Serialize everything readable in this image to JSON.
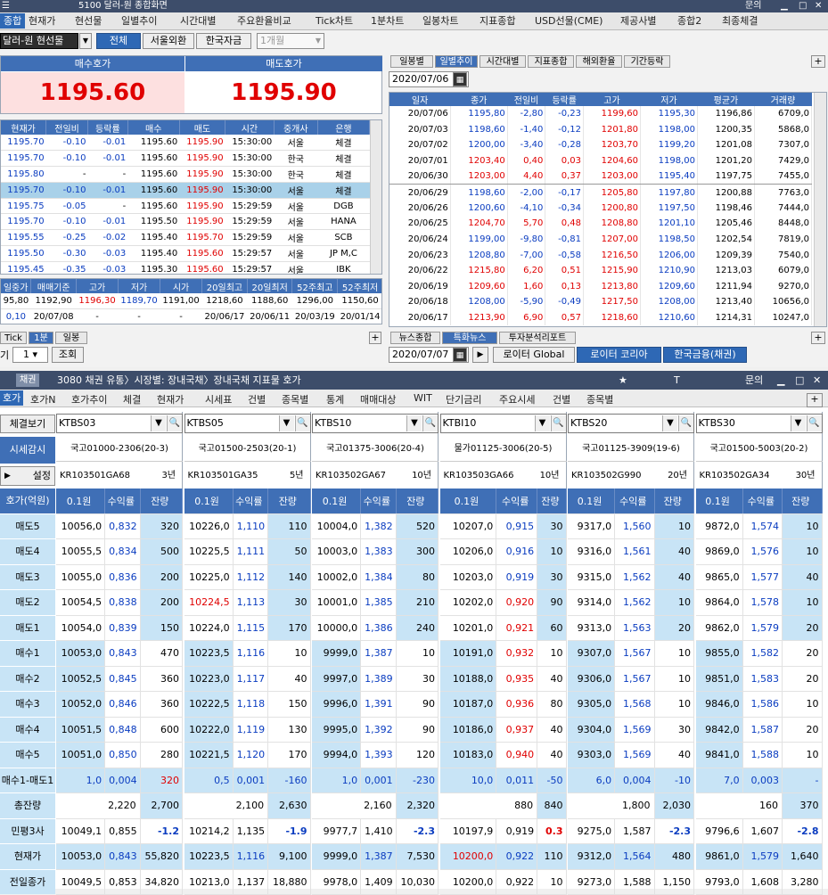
{
  "win1": {
    "title": "5100 달러-원 종합화면",
    "menu": [
      "종합",
      "현재가",
      "현선물",
      "일별추이",
      "시간대별",
      "주요환율비교",
      "Tick차트",
      "1분차트",
      "일봉차트",
      "지표종합",
      "USD선물(CME)",
      "제공사별",
      "종합2",
      "최종체결"
    ],
    "product": "달러-원 현선물",
    "buttons": [
      "전체",
      "서울외환",
      "한국자금"
    ],
    "period": "1개월",
    "bid_label": "매수호가",
    "ask_label": "매도호가",
    "bid": "1195.60",
    "ask": "1195.90",
    "qcols": [
      "현재가",
      "전일비",
      "등락률",
      "매수",
      "매도",
      "시간",
      "중개사",
      "은행"
    ],
    "qrows": [
      [
        "1195.70",
        "-0.10",
        "-0.01",
        "1195.60",
        "1195.90",
        "15:30:00",
        "서울",
        "체결"
      ],
      [
        "1195.70",
        "-0.10",
        "-0.01",
        "1195.60",
        "1195.90",
        "15:30:00",
        "한국",
        "체결"
      ],
      [
        "1195.80",
        "-",
        "-",
        "1195.60",
        "1195.90",
        "15:30:00",
        "한국",
        "체결"
      ],
      [
        "1195.70",
        "-0.10",
        "-0.01",
        "1195.60",
        "1195.90",
        "15:30:00",
        "서울",
        "체결"
      ],
      [
        "1195.75",
        "-0.05",
        "-",
        "1195.60",
        "1195.90",
        "15:29:59",
        "서울",
        "DGB"
      ],
      [
        "1195.70",
        "-0.10",
        "-0.01",
        "1195.50",
        "1195.90",
        "15:29:59",
        "서울",
        "HANA"
      ],
      [
        "1195.55",
        "-0.25",
        "-0.02",
        "1195.40",
        "1195.70",
        "15:29:59",
        "서울",
        "SCB"
      ],
      [
        "1195.50",
        "-0.30",
        "-0.03",
        "1195.40",
        "1195.60",
        "15:29:57",
        "서울",
        "JP M,C"
      ],
      [
        "1195.45",
        "-0.35",
        "-0.03",
        "1195.30",
        "1195.60",
        "15:29:57",
        "서울",
        "IBK"
      ]
    ],
    "scols": [
      "일중가",
      "매매기준",
      "고가",
      "저가",
      "시가",
      "20일최고",
      "20일최저",
      "52주최고",
      "52주최저"
    ],
    "srow1": [
      "95,80",
      "1192,90",
      "1196,30",
      "1189,70",
      "1191,00",
      "1218,60",
      "1188,60",
      "1296,00",
      "1150,60"
    ],
    "srow2": [
      "0,10",
      "20/07/08",
      "-",
      "-",
      "-",
      "20/06/17",
      "20/06/11",
      "20/03/19",
      "20/01/14"
    ],
    "bottom_tabs": [
      "Tick",
      "1분",
      "일봉"
    ],
    "count": "1",
    "query_btn": "조회",
    "rtabs": [
      "일봉별",
      "일별추이",
      "시간대별",
      "지표종합",
      "해외환율",
      "기간등락"
    ],
    "rdate": "2020/07/06",
    "dcols": [
      "일자",
      "종가",
      "전일비",
      "등락률",
      "고가",
      "저가",
      "평균가",
      "거래량"
    ],
    "drows": [
      [
        "20/07/06",
        "1195,80",
        "-2,80",
        "-0,23",
        "1199,60",
        "1195,30",
        "1196,86",
        "6709,0"
      ],
      [
        "20/07/03",
        "1198,60",
        "-1,40",
        "-0,12",
        "1201,80",
        "1198,00",
        "1200,35",
        "5868,0"
      ],
      [
        "20/07/02",
        "1200,00",
        "-3,40",
        "-0,28",
        "1203,70",
        "1199,20",
        "1201,08",
        "7307,0"
      ],
      [
        "20/07/01",
        "1203,40",
        "0,40",
        "0,03",
        "1204,60",
        "1198,00",
        "1201,20",
        "7429,0"
      ],
      [
        "20/06/30",
        "1203,00",
        "4,40",
        "0,37",
        "1203,00",
        "1195,40",
        "1197,75",
        "7455,0"
      ],
      [
        "20/06/29",
        "1198,60",
        "-2,00",
        "-0,17",
        "1205,80",
        "1197,80",
        "1200,88",
        "7763,0"
      ],
      [
        "20/06/26",
        "1200,60",
        "-4,10",
        "-0,34",
        "1200,80",
        "1197,50",
        "1198,46",
        "7444,0"
      ],
      [
        "20/06/25",
        "1204,70",
        "5,70",
        "0,48",
        "1208,80",
        "1201,10",
        "1205,46",
        "8448,0"
      ],
      [
        "20/06/24",
        "1199,00",
        "-9,80",
        "-0,81",
        "1207,00",
        "1198,50",
        "1202,54",
        "7819,0"
      ],
      [
        "20/06/23",
        "1208,80",
        "-7,00",
        "-0,58",
        "1216,50",
        "1206,00",
        "1209,39",
        "7540,0"
      ],
      [
        "20/06/22",
        "1215,80",
        "6,20",
        "0,51",
        "1215,90",
        "1210,90",
        "1213,03",
        "6079,0"
      ],
      [
        "20/06/19",
        "1209,60",
        "1,60",
        "0,13",
        "1213,80",
        "1209,60",
        "1211,94",
        "9270,0"
      ],
      [
        "20/06/18",
        "1208,00",
        "-5,90",
        "-0,49",
        "1217,50",
        "1208,00",
        "1213,40",
        "10656,0"
      ],
      [
        "20/06/17",
        "1213,90",
        "6,90",
        "0,57",
        "1218,60",
        "1210,60",
        "1214,31",
        "10247,0"
      ]
    ],
    "newstabs": [
      "뉴스종합",
      "특화뉴스",
      "투자분석리포트"
    ],
    "ndate": "2020/07/07",
    "newsbtns": [
      "로이터 Global",
      "로이터 코리아",
      "한국금융(채권)"
    ]
  },
  "win2": {
    "title": "3080 채권 유통〉시장별: 장내국채〉장내국채 지표물 호가",
    "title_left": "채권",
    "right_label": "문의",
    "menu": [
      "호가",
      "호가N",
      "호가추이",
      "체결",
      "현재가",
      "시세표",
      "건별",
      "종목별",
      "통계",
      "매매대상",
      "WIT",
      "단기금리",
      "주요시세",
      "건별",
      "종목별"
    ],
    "btn_view": "체결보기",
    "btn_market": "시세감시",
    "btn_set": "설정",
    "rowlabels": [
      "호가(억원)",
      "매도5",
      "매도4",
      "매도3",
      "매도2",
      "매도1",
      "매수1",
      "매수2",
      "매수3",
      "매수4",
      "매수5",
      "매수1-매도1",
      "총잔량",
      "민평3사",
      "현재가",
      "전일종가"
    ],
    "subcols": [
      "0.1원",
      "수익률",
      "잔량"
    ],
    "bonds": [
      {
        "code": "KTBS03",
        "name": "국고01000-2306(20-3)",
        "isin": "KR103501GA68",
        "term": "3년",
        "rows": [
          [
            "10056,0",
            "0,832",
            "320"
          ],
          [
            "10055,5",
            "0,834",
            "500"
          ],
          [
            "10055,0",
            "0,836",
            "200"
          ],
          [
            "10054,5",
            "0,838",
            "200"
          ],
          [
            "10054,0",
            "0,839",
            "150"
          ],
          [
            "10053,0",
            "0,843",
            "470"
          ],
          [
            "10052,5",
            "0,845",
            "360"
          ],
          [
            "10052,0",
            "0,846",
            "360"
          ],
          [
            "10051,5",
            "0,848",
            "600"
          ],
          [
            "10051,0",
            "0,850",
            "280"
          ],
          [
            "1,0",
            "0,004",
            "320"
          ]
        ],
        "tot": [
          "2,220",
          "2,700"
        ],
        "mp": [
          "10049,1",
          "0,855",
          "-1.2"
        ],
        "cur": [
          "10053,0",
          "0,843",
          "55,820"
        ],
        "prev": [
          "10049,5",
          "0,853",
          "34,820"
        ]
      },
      {
        "code": "KTBS05",
        "name": "국고01500-2503(20-1)",
        "isin": "KR103501GA35",
        "term": "5년",
        "rows": [
          [
            "10226,0",
            "1,110",
            "110"
          ],
          [
            "10225,5",
            "1,111",
            "50"
          ],
          [
            "10225,0",
            "1,112",
            "140"
          ],
          [
            "10224,5",
            "1,113",
            "30"
          ],
          [
            "10224,0",
            "1,115",
            "170"
          ],
          [
            "10223,5",
            "1,116",
            "10"
          ],
          [
            "10223,0",
            "1,117",
            "40"
          ],
          [
            "10222,5",
            "1,118",
            "150"
          ],
          [
            "10222,0",
            "1,119",
            "130"
          ],
          [
            "10221,5",
            "1,120",
            "170"
          ],
          [
            "0,5",
            "0,001",
            "-160"
          ]
        ],
        "tot": [
          "2,100",
          "2,630"
        ],
        "mp": [
          "10214,2",
          "1,135",
          "-1.9"
        ],
        "cur": [
          "10223,5",
          "1,116",
          "9,100"
        ],
        "prev": [
          "10213,0",
          "1,137",
          "18,880"
        ]
      },
      {
        "code": "KTBS10",
        "name": "국고01375-3006(20-4)",
        "isin": "KR103502GA67",
        "term": "10년",
        "rows": [
          [
            "10004,0",
            "1,382",
            "520"
          ],
          [
            "10003,0",
            "1,383",
            "300"
          ],
          [
            "10002,0",
            "1,384",
            "80"
          ],
          [
            "10001,0",
            "1,385",
            "210"
          ],
          [
            "10000,0",
            "1,386",
            "240"
          ],
          [
            "9999,0",
            "1,387",
            "10"
          ],
          [
            "9997,0",
            "1,389",
            "30"
          ],
          [
            "9996,0",
            "1,391",
            "90"
          ],
          [
            "9995,0",
            "1,392",
            "90"
          ],
          [
            "9994,0",
            "1,393",
            "120"
          ],
          [
            "1,0",
            "0,001",
            "-230"
          ]
        ],
        "tot": [
          "2,160",
          "2,320"
        ],
        "mp": [
          "9977,7",
          "1,410",
          "-2.3"
        ],
        "cur": [
          "9999,0",
          "1,387",
          "7,530"
        ],
        "prev": [
          "9978,0",
          "1,409",
          "10,030"
        ]
      },
      {
        "code": "KTBI10",
        "name": "물가01125-3006(20-5)",
        "isin": "KR103503GA66",
        "term": "10년",
        "rows": [
          [
            "10207,0",
            "0,915",
            "30"
          ],
          [
            "10206,0",
            "0,916",
            "10"
          ],
          [
            "10203,0",
            "0,919",
            "30"
          ],
          [
            "10202,0",
            "0,920",
            "90"
          ],
          [
            "10201,0",
            "0,921",
            "60"
          ],
          [
            "10191,0",
            "0,932",
            "10"
          ],
          [
            "10188,0",
            "0,935",
            "40"
          ],
          [
            "10187,0",
            "0,936",
            "80"
          ],
          [
            "10186,0",
            "0,937",
            "40"
          ],
          [
            "10183,0",
            "0,940",
            "40"
          ],
          [
            "10,0",
            "0,011",
            "-50"
          ]
        ],
        "tot": [
          "880",
          "840"
        ],
        "mp": [
          "10197,9",
          "0,919",
          "0.3"
        ],
        "cur": [
          "10200,0",
          "0,922",
          "110"
        ],
        "prev": [
          "10200,0",
          "0,922",
          "10"
        ]
      },
      {
        "code": "KTBS20",
        "name": "국고01125-3909(19-6)",
        "isin": "KR103502G990",
        "term": "20년",
        "rows": [
          [
            "9317,0",
            "1,560",
            "10"
          ],
          [
            "9316,0",
            "1,561",
            "40"
          ],
          [
            "9315,0",
            "1,562",
            "40"
          ],
          [
            "9314,0",
            "1,562",
            "10"
          ],
          [
            "9313,0",
            "1,563",
            "20"
          ],
          [
            "9307,0",
            "1,567",
            "10"
          ],
          [
            "9306,0",
            "1,567",
            "10"
          ],
          [
            "9305,0",
            "1,568",
            "10"
          ],
          [
            "9304,0",
            "1,569",
            "30"
          ],
          [
            "9303,0",
            "1,569",
            "40"
          ],
          [
            "6,0",
            "0,004",
            "-10"
          ]
        ],
        "tot": [
          "1,800",
          "2,030"
        ],
        "mp": [
          "9275,0",
          "1,587",
          "-2.3"
        ],
        "cur": [
          "9312,0",
          "1,564",
          "480"
        ],
        "prev": [
          "9273,0",
          "1,588",
          "1,150"
        ]
      },
      {
        "code": "KTBS30",
        "name": "국고01500-5003(20-2)",
        "isin": "KR103502GA34",
        "term": "30년",
        "rows": [
          [
            "9872,0",
            "1,574",
            "10"
          ],
          [
            "9869,0",
            "1,576",
            "10"
          ],
          [
            "9865,0",
            "1,577",
            "40"
          ],
          [
            "9864,0",
            "1,578",
            "10"
          ],
          [
            "9862,0",
            "1,579",
            "20"
          ],
          [
            "9855,0",
            "1,582",
            "20"
          ],
          [
            "9851,0",
            "1,583",
            "20"
          ],
          [
            "9846,0",
            "1,586",
            "10"
          ],
          [
            "9842,0",
            "1,587",
            "20"
          ],
          [
            "9841,0",
            "1,588",
            "10"
          ],
          [
            "7,0",
            "0,003",
            "-"
          ]
        ],
        "tot": [
          "160",
          "370"
        ],
        "mp": [
          "9796,6",
          "1,607",
          "-2.8"
        ],
        "cur": [
          "9861,0",
          "1,579",
          "1,640"
        ],
        "prev": [
          "9793,0",
          "1,608",
          "3,280"
        ]
      }
    ]
  }
}
